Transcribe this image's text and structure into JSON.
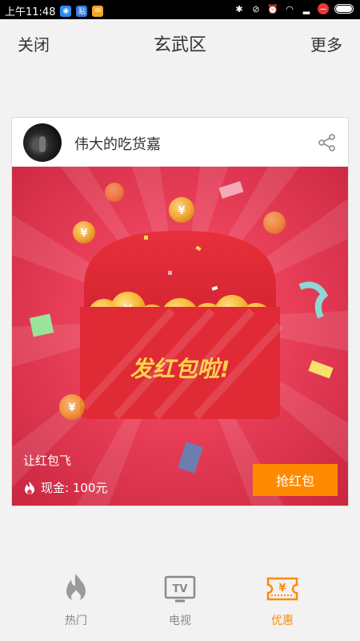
{
  "status_bar": {
    "time": "上午11:48",
    "notification_badge": "贴"
  },
  "header": {
    "close_label": "关闭",
    "title": "玄武区",
    "more_label": "更多"
  },
  "card": {
    "username": "伟大的吃货嘉",
    "banner_text": "发红包啦!",
    "promo_text": "让红包飞",
    "cash_text": "现金: 100元",
    "grab_button": "抢红包"
  },
  "bottom_nav": {
    "items": [
      {
        "label": "热门",
        "icon": "flame-icon",
        "active": false
      },
      {
        "label": "电视",
        "icon": "tv-icon",
        "active": false
      },
      {
        "label": "优惠",
        "icon": "coupon-icon",
        "active": true
      }
    ],
    "active_color": "#ff8a00",
    "inactive_color": "#888888"
  },
  "colors": {
    "accent": "#ff8a00",
    "banner_red": "#e83e58",
    "envelope_red": "#e02a36",
    "coin_gold": "#f7b733"
  },
  "tv_icon_text": "TV",
  "coupon_icon_text": "¥",
  "coin_symbol": "¥"
}
